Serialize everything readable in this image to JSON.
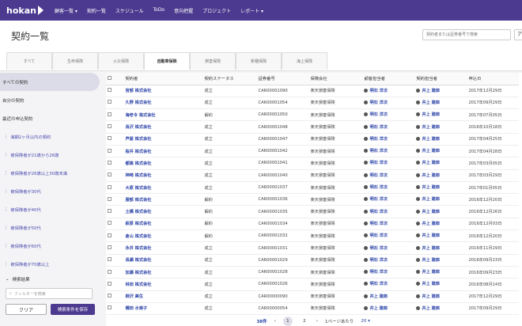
{
  "logo": "hokan",
  "nav": [
    "顧客一覧 ▾",
    "契約一覧",
    "スケジュール",
    "ToDo",
    "意向把握",
    "プロジェクト",
    "レポート ▾"
  ],
  "header": {
    "title": "契約一覧",
    "search_placeholder": "契約者または証券番号で検索",
    "search_button": "ア"
  },
  "tabs": [
    "すべて",
    "生命保険",
    "火災保険",
    "自動車保険",
    "損害保険",
    "新種保険",
    "海上保険"
  ],
  "active_tab": 3,
  "sidebar": {
    "items": [
      "すべての契約",
      "自分の契約",
      "最近の申込契約"
    ],
    "sub_items": [
      "満期2ヶ月以内の契約",
      "被保険者が21歳から26歳",
      "被保険者が26歳以上30歳未満",
      "被保険者が30代",
      "被保険者が40代",
      "被保険者が50代",
      "被保険者が60代",
      "被保険者が70歳以上"
    ],
    "section": "検索結果",
    "filter_placeholder": "フィルターを検索",
    "clear": "クリア",
    "save": "検索条件を保存"
  },
  "table": {
    "headers": [
      "契約者",
      "契約ステータス",
      "証券番号",
      "保険会社",
      "顧客担当者",
      "契約担当者",
      "申込日"
    ],
    "rows": [
      [
        "宮部 株式会社",
        "成立",
        "CAR00001090",
        "楽天損害保険",
        "明石 洋次",
        "井上 建郎",
        "2017年12月29日"
      ],
      [
        "久野 株式会社",
        "成立",
        "CAR00001054",
        "楽天損害保険",
        "明石 洋次",
        "井上 建郎",
        "2017年09月29日"
      ],
      [
        "海老令 株式会社",
        "解約",
        "CAR00001050",
        "楽天損害保険",
        "明石 洋次",
        "井上 建郎",
        "2017年07月05日"
      ],
      [
        "長沢 株式会社",
        "成立",
        "CAR00001048",
        "楽天損害保険",
        "明石 洋次",
        "井上 建郎",
        "2016年10月18日"
      ],
      [
        "芦屋 株式会社",
        "成立",
        "CAR00001047",
        "楽天損害保険",
        "明石 洋次",
        "井上 建郎",
        "2017年04月25日"
      ],
      [
        "桜井 株式会社",
        "成立",
        "CAR00001042",
        "楽天損害保険",
        "明石 洋次",
        "井上 建郎",
        "2017年04月28日"
      ],
      [
        "都築 株式会社",
        "成立",
        "CAR00001041",
        "楽天損害保険",
        "明石 洋次",
        "井上 建郎",
        "2017年03月05日"
      ],
      [
        "神崎 株式会社",
        "成立",
        "CAR00001040",
        "楽天損害保険",
        "明石 洋次",
        "井上 建郎",
        "2017年03月29日"
      ],
      [
        "大原 株式会社",
        "成立",
        "CAR00001037",
        "楽天損害保険",
        "明石 洋次",
        "井上 建郎",
        "2017年01月05日"
      ],
      [
        "服部 株式会社",
        "解約",
        "CAR00001036",
        "楽天損害保険",
        "明石 洋次",
        "井上 建郎",
        "2016年12月20日"
      ],
      [
        "土橋 株式会社",
        "解約",
        "CAR00001035",
        "楽天損害保険",
        "明石 洋次",
        "井上 建郎",
        "2016年12月26日"
      ],
      [
        "萩原 株式会社",
        "解約",
        "CAR00001034",
        "楽天損害保険",
        "明石 洋次",
        "井上 建郎",
        "2016年12月03日"
      ],
      [
        "倉山 株式会社",
        "解約",
        "CAR00001032",
        "楽天損害保険",
        "明石 洋次",
        "井上 建郎",
        "2016年12月20日"
      ],
      [
        "永井 株式会社",
        "成立",
        "CAR00001031",
        "楽天損害保険",
        "明石 洋次",
        "井上 建郎",
        "2016年11月29日"
      ],
      [
        "長瀬 株式会社",
        "成立",
        "CAR00001029",
        "楽天損害保険",
        "明石 洋次",
        "井上 建郎",
        "2016年09月23日"
      ],
      [
        "加瀬 株式会社",
        "成立",
        "CAR00001028",
        "楽天損害保険",
        "明石 洋次",
        "井上 建郎",
        "2016年09月23日"
      ],
      [
        "林田 株式会社",
        "成立",
        "CAR00001026",
        "楽天損害保険",
        "明石 洋次",
        "井上 建郎",
        "2016年08月14日"
      ],
      [
        "柳沢 美生",
        "成立",
        "CAR00000090",
        "楽天損害保険",
        "井上 建郎",
        "井上 建郎",
        "2017年12月29日"
      ],
      [
        "種田 水楽子",
        "成立",
        "CAR00000054",
        "楽天損害保険",
        "井上 建郎",
        "井上 建郎",
        "2017年09月29日"
      ]
    ]
  },
  "pager": {
    "count": "38件",
    "pages": [
      "1",
      "2"
    ],
    "per_page_label": "1ページあたり",
    "per_page": "20 ▾"
  }
}
